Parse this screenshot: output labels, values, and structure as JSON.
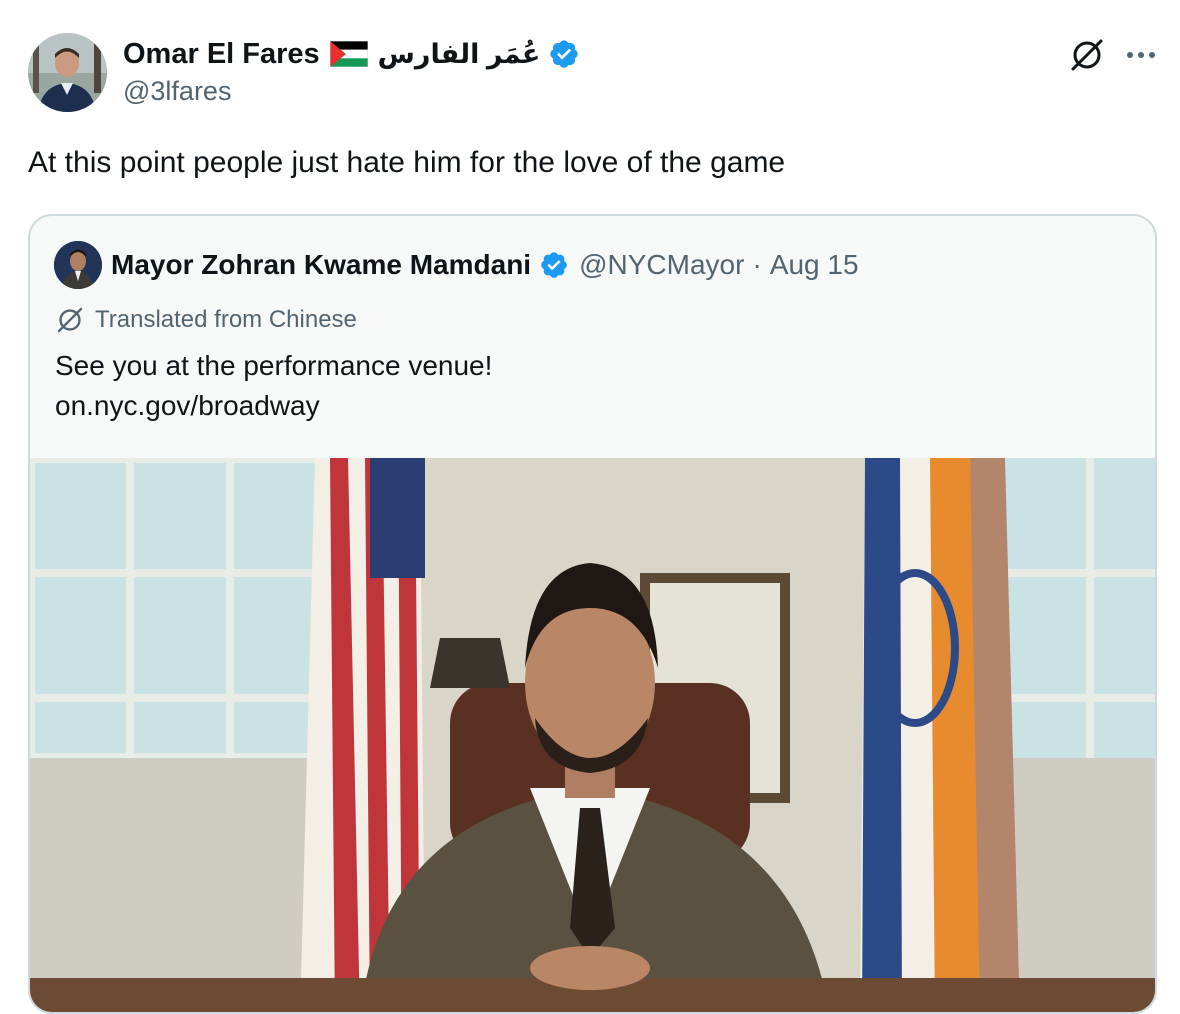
{
  "tweet": {
    "author": {
      "name": "Omar El Fares",
      "arabic_name": "عُمَر الفارس",
      "handle": "@3lfares",
      "verified_color": "#1d9bf0"
    },
    "text": "At this point people just hate him for the love of the game",
    "icons": [
      "grok-icon",
      "more-icon"
    ]
  },
  "quote": {
    "author_name": "Mayor Zohran Kwame Mamdani",
    "handle": "@NYCMayor",
    "separator": "·",
    "date": "Aug 15",
    "translated_label": "Translated from Chinese",
    "text_line1": "See you at the performance venue!",
    "text_line2": "on.nyc.gov/broadway"
  },
  "colors": {
    "text_primary": "#0f1419",
    "text_secondary": "#536471",
    "border": "#cfd9de",
    "verified": "#1d9bf0"
  }
}
